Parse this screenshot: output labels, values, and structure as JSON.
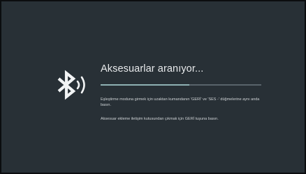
{
  "dialog": {
    "title": "Aksesuarlar aranıyor...",
    "progress": 0.55,
    "instructions": [
      "Eşleştirme moduna girmek için uzaktan kumandanın 'GERİ' ve 'SES -' düğmelerine aynı anda basın.",
      "Aksesuar ekleme iletişim kutusundan çıkmak için GERİ tuşuna basın."
    ]
  },
  "icons": {
    "bluetooth": "bluetooth-searching-icon"
  },
  "colors": {
    "background": "#283036",
    "outer_frame": "#0b0d0f",
    "title_text": "#e8eaec",
    "body_text": "#cfd3d6",
    "progress_track": "#59646b",
    "progress_fill": "#8fb1b4"
  }
}
